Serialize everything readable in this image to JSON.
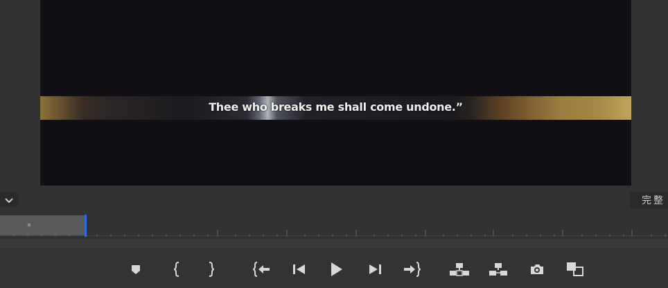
{
  "monitor": {
    "subtitle": "Thee who breaks me shall come undone.”"
  },
  "controls": {
    "zoom_icon": "chevron-down-icon",
    "quality_label": "完整"
  },
  "transport": {
    "buttons": [
      {
        "name": "add-marker",
        "icon": "marker-icon"
      },
      {
        "name": "mark-in",
        "icon": "mark-in-icon"
      },
      {
        "name": "mark-out",
        "icon": "mark-out-icon"
      },
      {
        "name": "go-to-in",
        "icon": "go-to-in-icon"
      },
      {
        "name": "step-back",
        "icon": "step-back-icon"
      },
      {
        "name": "play",
        "icon": "play-icon"
      },
      {
        "name": "step-forward",
        "icon": "step-forward-icon"
      },
      {
        "name": "go-to-out",
        "icon": "go-to-out-icon"
      },
      {
        "name": "lift",
        "icon": "lift-icon"
      },
      {
        "name": "extract",
        "icon": "extract-icon"
      },
      {
        "name": "export-frame",
        "icon": "camera-icon"
      },
      {
        "name": "comparison-view",
        "icon": "comparison-view-icon"
      }
    ]
  },
  "colors": {
    "panel_bg": "#323232",
    "video_bg": "#121015",
    "playhead": "#2d6cdf",
    "icon": "#d8d8d8"
  }
}
